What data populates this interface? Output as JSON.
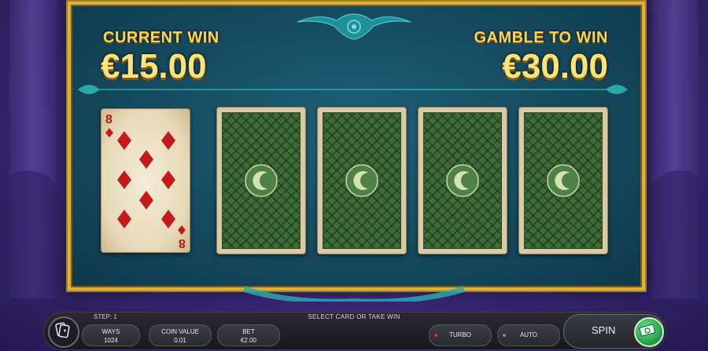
{
  "header": {
    "current_win_label": "CURRENT WIN",
    "current_win_value": "€15.00",
    "gamble_label": "GAMBLE TO WIN",
    "gamble_value": "€30.00"
  },
  "cards": {
    "dealer": {
      "rank": "8",
      "suit": "diamonds",
      "color": "#c41a1a"
    },
    "choices": [
      "face-down",
      "face-down",
      "face-down",
      "face-down"
    ]
  },
  "bottom_bar": {
    "step": "STEP: 1",
    "message": "SELECT CARD OR TAKE WIN",
    "ways_label": "WAYS",
    "ways_value": "1024",
    "coin_label": "COIN VALUE",
    "coin_value": "0.01",
    "bet_label": "BET",
    "bet_value": "€2.00",
    "turbo_label": "TURBO",
    "auto_label": "AUTO",
    "spin_label": "SPIN"
  },
  "colors": {
    "gold": "#f7d35a",
    "table_teal": "#1f6278",
    "frame": "#d9b23a",
    "card_back_green": "#3f6a3a",
    "spin_green": "#1d9a46"
  },
  "icons": {
    "menu": "cards-menu-icon",
    "spin": "cash-spin-icon",
    "card_back_emblem": "crescent-emblem-icon"
  }
}
